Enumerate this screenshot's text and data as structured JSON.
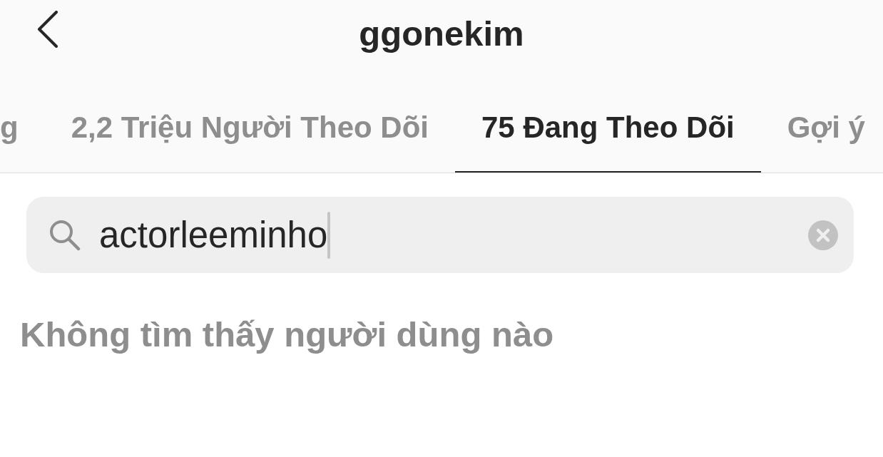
{
  "header": {
    "title": "ggonekim"
  },
  "tabs": [
    {
      "label": "g",
      "selected": false
    },
    {
      "label": "2,2 Triệu Người Theo Dõi",
      "selected": false
    },
    {
      "label": "75 Đang Theo Dõi",
      "selected": true
    },
    {
      "label": "Gợi ý",
      "selected": false
    }
  ],
  "search": {
    "value": "actorleeminho",
    "focused": true
  },
  "empty_message": "Không tìm thấy người dùng nào"
}
